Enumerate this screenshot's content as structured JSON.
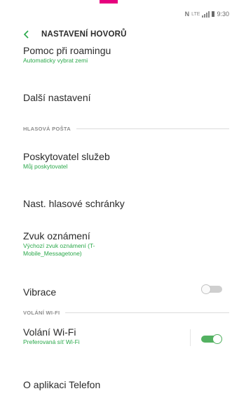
{
  "status_bar": {
    "time": "9:30",
    "network": "LTE",
    "nfc": "N"
  },
  "header": {
    "title": "NASTAVENÍ HOVORŮ"
  },
  "items": {
    "roaming": {
      "title": "Pomoc při roamingu",
      "subtitle": "Automaticky vybrat zemi"
    },
    "more_settings": {
      "title": "Další nastavení"
    },
    "service_provider": {
      "title": "Poskytovatel služeb",
      "subtitle": "Můj poskytovatel"
    },
    "voicemail_settings": {
      "title": "Nast. hlasové schránky"
    },
    "notification_sound": {
      "title": "Zvuk oznámení",
      "subtitle": "Výchozí zvuk oznámení (T-Mobile_Messagetone)"
    },
    "vibration": {
      "title": "Vibrace",
      "enabled": false
    },
    "wifi_calling": {
      "title": "Volání Wi-Fi",
      "subtitle": "Preferovaná síť Wi-Fi",
      "enabled": true
    },
    "about_phone": {
      "title": "O aplikaci Telefon"
    }
  },
  "sections": {
    "voicemail": "HLASOVÁ POŠTA",
    "wifi": "VOLÁNÍ WI-FI"
  },
  "colors": {
    "accent_green": "#2aa84a",
    "toggle_on": "#53b161",
    "brand_pink": "#e6007e"
  }
}
